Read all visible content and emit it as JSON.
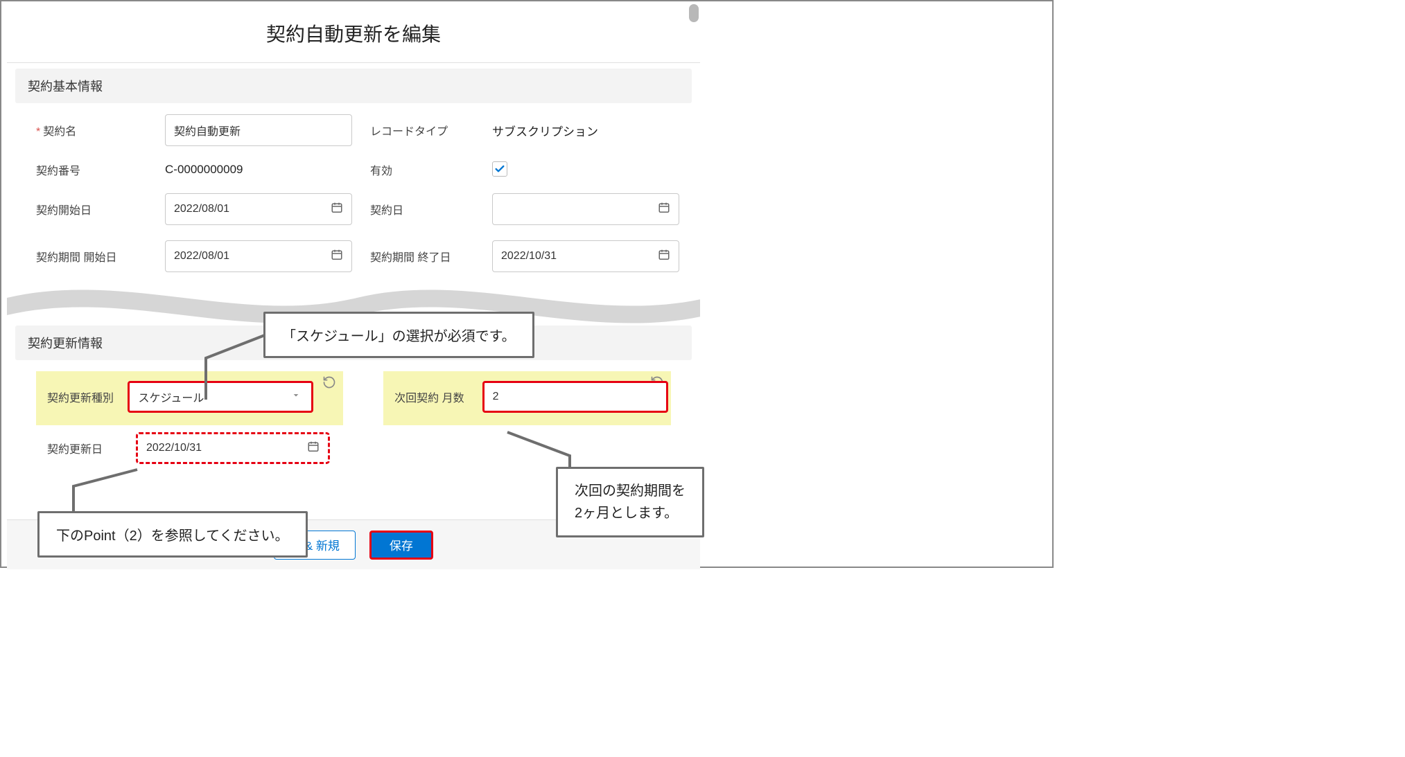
{
  "modal": {
    "title": "契約自動更新を編集"
  },
  "section1": {
    "header": "契約基本情報",
    "contractNameLabel": "契約名",
    "contractNameValue": "契約自動更新",
    "recordTypeLabel": "レコードタイプ",
    "recordTypeValue": "サブスクリプション",
    "contractNumberLabel": "契約番号",
    "contractNumberValue": "C-0000000009",
    "activeLabel": "有効",
    "startDateLabel": "契約開始日",
    "startDateValue": "2022/08/01",
    "contractDateLabel": "契約日",
    "contractDateValue": "",
    "periodStartLabel": "契約期間 開始日",
    "periodStartValue": "2022/08/01",
    "periodEndLabel": "契約期間 終了日",
    "periodEndValue": "2022/10/31"
  },
  "section2": {
    "header": "契約更新情報",
    "renewTypeLabel": "契約更新種別",
    "renewTypeValue": "スケジュール",
    "nextMonthsLabel": "次回契約 月数",
    "nextMonthsValue": "2",
    "renewDateLabel": "契約更新日",
    "renewDateValue": "2022/10/31"
  },
  "footer": {
    "saveAndNewPartial": "存 & 新規",
    "save": "保存"
  },
  "callouts": {
    "scheduleRequired": "「スケジュール」の選択が必須です。",
    "seePoint2": "下のPoint（2）を参照してください。",
    "nextPeriodLine1": "次回の契約期間を",
    "nextPeriodLine2": "2ヶ月とします。"
  }
}
